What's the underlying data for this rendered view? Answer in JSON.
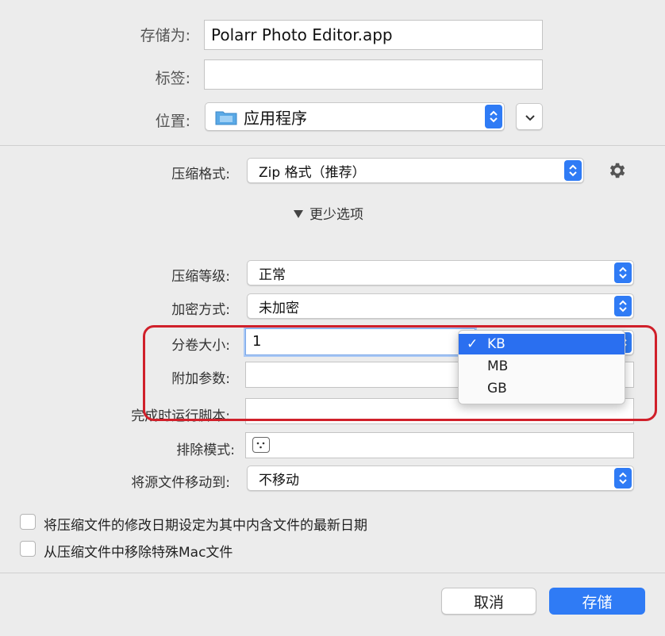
{
  "save": {
    "save_as_label": "存储为:",
    "save_as_value": "Polarr Photo Editor.app",
    "tags_label": "标签:",
    "tags_value": "",
    "location_label": "位置:",
    "location_value": "应用程序"
  },
  "compression": {
    "format_label": "压缩格式:",
    "format_value": "Zip 格式（推荐）",
    "fewer_options": "更少选项",
    "level_label": "压缩等级:",
    "level_value": "正常",
    "encryption_label": "加密方式:",
    "encryption_value": "未加密",
    "volume_label": "分卷大小:",
    "volume_value": "1",
    "volume_unit_options": [
      "KB",
      "MB",
      "GB"
    ],
    "volume_unit_selected": "KB",
    "extra_params_label": "附加参数:",
    "extra_params_value": "",
    "run_script_label": "完成时运行脚本:",
    "run_script_value": "",
    "exclude_label": "排除模式:",
    "move_source_label": "将源文件移动到:",
    "move_source_value": "不移动"
  },
  "checkboxes": [
    {
      "label": "将压缩文件的修改日期设定为其中内含文件的最新日期",
      "checked": false
    },
    {
      "label": "从压缩文件中移除特殊Mac文件",
      "checked": false
    }
  ],
  "buttons": {
    "cancel": "取消",
    "save": "存储"
  },
  "colors": {
    "accent": "#2f7bf5",
    "highlight": "#d0202a"
  }
}
